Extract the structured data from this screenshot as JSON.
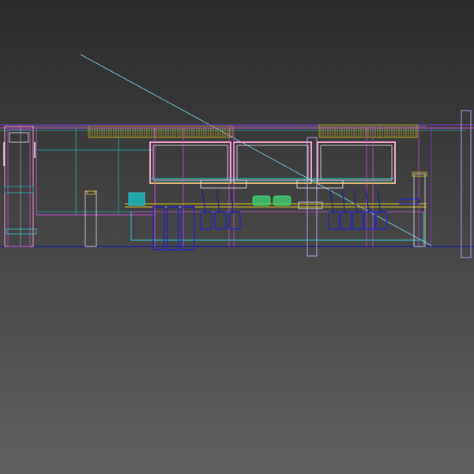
{
  "viewport": {
    "view": "3D viewport",
    "render_mode": "wireframe",
    "background": {
      "top": "#2b2b2b",
      "bottom": "#606060"
    }
  },
  "wire_colors": {
    "cyan": "#2ec4c4",
    "magenta": "#c04ec8",
    "pink": "#f2a2c6",
    "white": "#e8e8f0",
    "blue": "#2424c8",
    "navy": "#1a1aa0",
    "green": "#40d070",
    "yellow": "#d8c020",
    "olive": "#a89a28",
    "lavender": "#b8a0e8",
    "teal": "#20a8a8",
    "purple": "#7a3ad0",
    "light_blue": "#7ad0f0"
  },
  "icons": {
    "mesh": "wireframe-kitchen-counter"
  }
}
